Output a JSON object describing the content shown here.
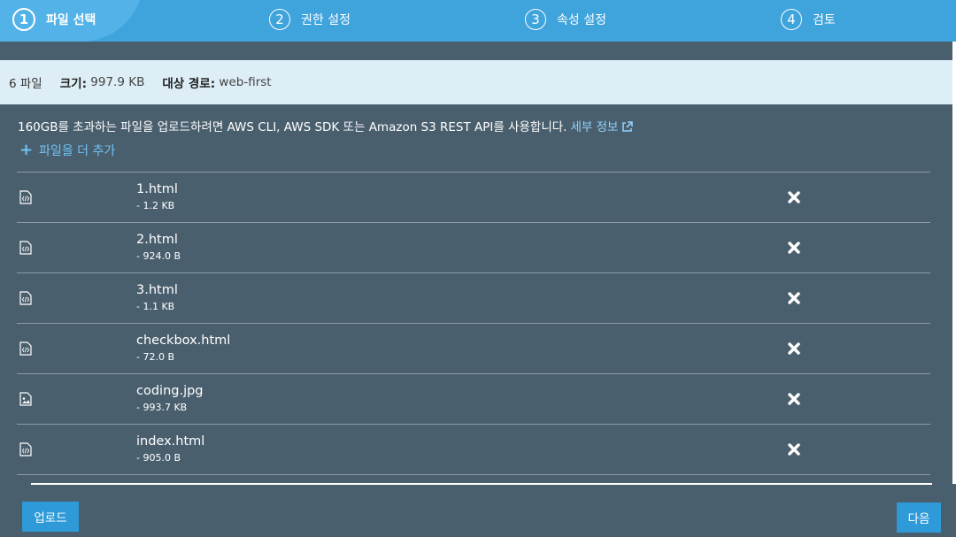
{
  "steps": [
    {
      "num": "1",
      "label": "파일 선택",
      "active": true
    },
    {
      "num": "2",
      "label": "권한 설정",
      "active": false
    },
    {
      "num": "3",
      "label": "속성 설정",
      "active": false
    },
    {
      "num": "4",
      "label": "검토",
      "active": false
    }
  ],
  "summary": {
    "file_count": "6 파일",
    "size_label": "크기:",
    "size_value": "997.9 KB",
    "target_label": "대상 경로:",
    "target_value": "web-first"
  },
  "notice": {
    "text": "160GB를 초과하는 파일을 업로드하려면 AWS CLI, AWS SDK 또는 Amazon S3 REST API를 사용합니다.",
    "link": "세부 정보",
    "link_icon": "external-link-icon"
  },
  "add_more": {
    "label": "파일을 더 추가",
    "icon": "plus-icon"
  },
  "files": [
    {
      "name": "1.html",
      "size": "- 1.2 KB",
      "icon": "code-file-icon"
    },
    {
      "name": "2.html",
      "size": "- 924.0 B",
      "icon": "code-file-icon"
    },
    {
      "name": "3.html",
      "size": "- 1.1 KB",
      "icon": "code-file-icon"
    },
    {
      "name": "checkbox.html",
      "size": "- 72.0 B",
      "icon": "code-file-icon"
    },
    {
      "name": "coding.jpg",
      "size": "- 993.7 KB",
      "icon": "image-file-icon"
    },
    {
      "name": "index.html",
      "size": "- 905.0 B",
      "icon": "code-file-icon"
    }
  ],
  "buttons": {
    "upload": "업로드",
    "next": "다음"
  },
  "colors": {
    "accent": "#3fa3dc",
    "background": "#4a5f6e",
    "summary_bg": "#ddeef6",
    "link": "#8fd3fb",
    "button": "#2f9ad8"
  }
}
